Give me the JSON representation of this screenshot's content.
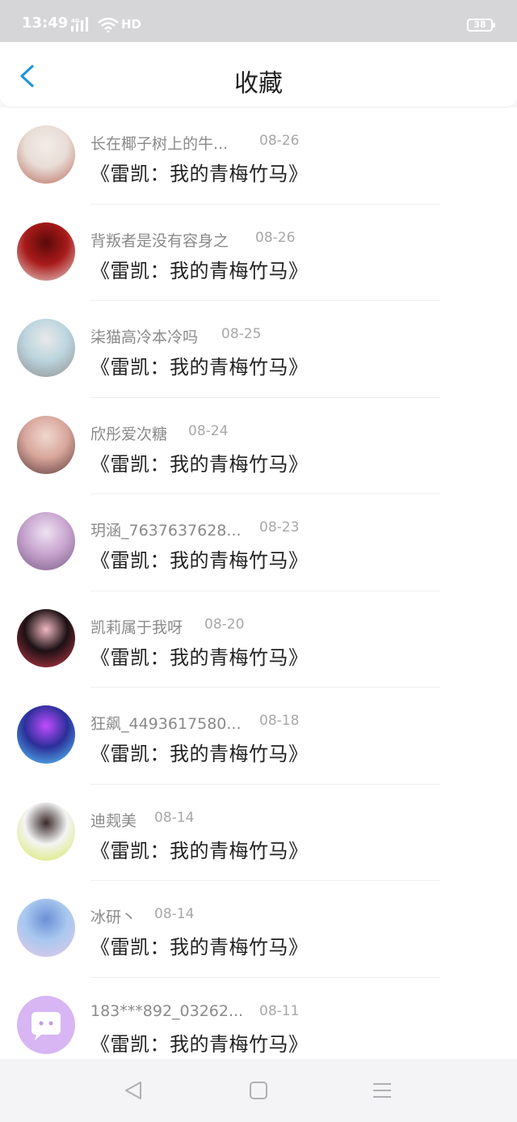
{
  "status": {
    "time": "13:49",
    "network": "4G",
    "hd": "HD",
    "battery": "38"
  },
  "header": {
    "title": "收藏"
  },
  "items": [
    {
      "username": "长在椰子树上的牛...",
      "date": "08-26",
      "title": "《雷凯：我的青梅竹马》",
      "avatar_colors": [
        "#e8ddd6",
        "#b96b5d",
        "#f3ece7"
      ]
    },
    {
      "username": "背叛者是没有容身之",
      "date": "08-26",
      "title": "《雷凯：我的青梅竹马》",
      "avatar_colors": [
        "#a81a1a",
        "#e8d6d0",
        "#5a0a0a"
      ]
    },
    {
      "username": "柒猫高冷本冷吗",
      "date": "08-25",
      "title": "《雷凯：我的青梅竹马》",
      "avatar_colors": [
        "#bcd5de",
        "#8f8f8f",
        "#e9e9e9"
      ]
    },
    {
      "username": "欣彤爱次糖",
      "date": "08-24",
      "title": "《雷凯：我的青梅竹马》",
      "avatar_colors": [
        "#d9a79c",
        "#5b3a3a",
        "#efd8cf"
      ]
    },
    {
      "username": "玥涵_7637637628...",
      "date": "08-23",
      "title": "《雷凯：我的青梅竹马》",
      "avatar_colors": [
        "#c8a6cf",
        "#7a5d88",
        "#efe2f2"
      ]
    },
    {
      "username": "凯莉属于我呀",
      "date": "08-20",
      "title": "《雷凯：我的青梅竹马》",
      "avatar_colors": [
        "#1c1114",
        "#c93a4b",
        "#f1b8c0"
      ]
    },
    {
      "username": "狂飙_4493617580...",
      "date": "08-18",
      "title": "《雷凯：我的青梅竹马》",
      "avatar_colors": [
        "#2b2f9a",
        "#5ad0ff",
        "#c04cff"
      ]
    },
    {
      "username": "迪觌美",
      "date": "08-14",
      "title": "《雷凯：我的青梅竹马》",
      "avatar_colors": [
        "#f4f4f4",
        "#d6e85a",
        "#3a2a2a"
      ]
    },
    {
      "username": "冰研丶",
      "date": "08-14",
      "title": "《雷凯：我的青梅竹马》",
      "avatar_colors": [
        "#a8c8ef",
        "#e8c8e8",
        "#6c8fd6"
      ]
    },
    {
      "username": "183***892_03262...",
      "date": "08-11",
      "title": "《雷凯：我的青梅竹马》",
      "avatar_colors": [
        "#d7b6f3",
        "#ffffff",
        "#c39ae8"
      ]
    }
  ],
  "colors": {
    "accent": "#1b95e0",
    "text": "#222222",
    "meta": "#8a8a8a"
  },
  "icons": {
    "back": "chevron-left-icon",
    "nav": [
      "back-triangle-icon",
      "home-square-icon",
      "menu-lines-icon"
    ]
  }
}
